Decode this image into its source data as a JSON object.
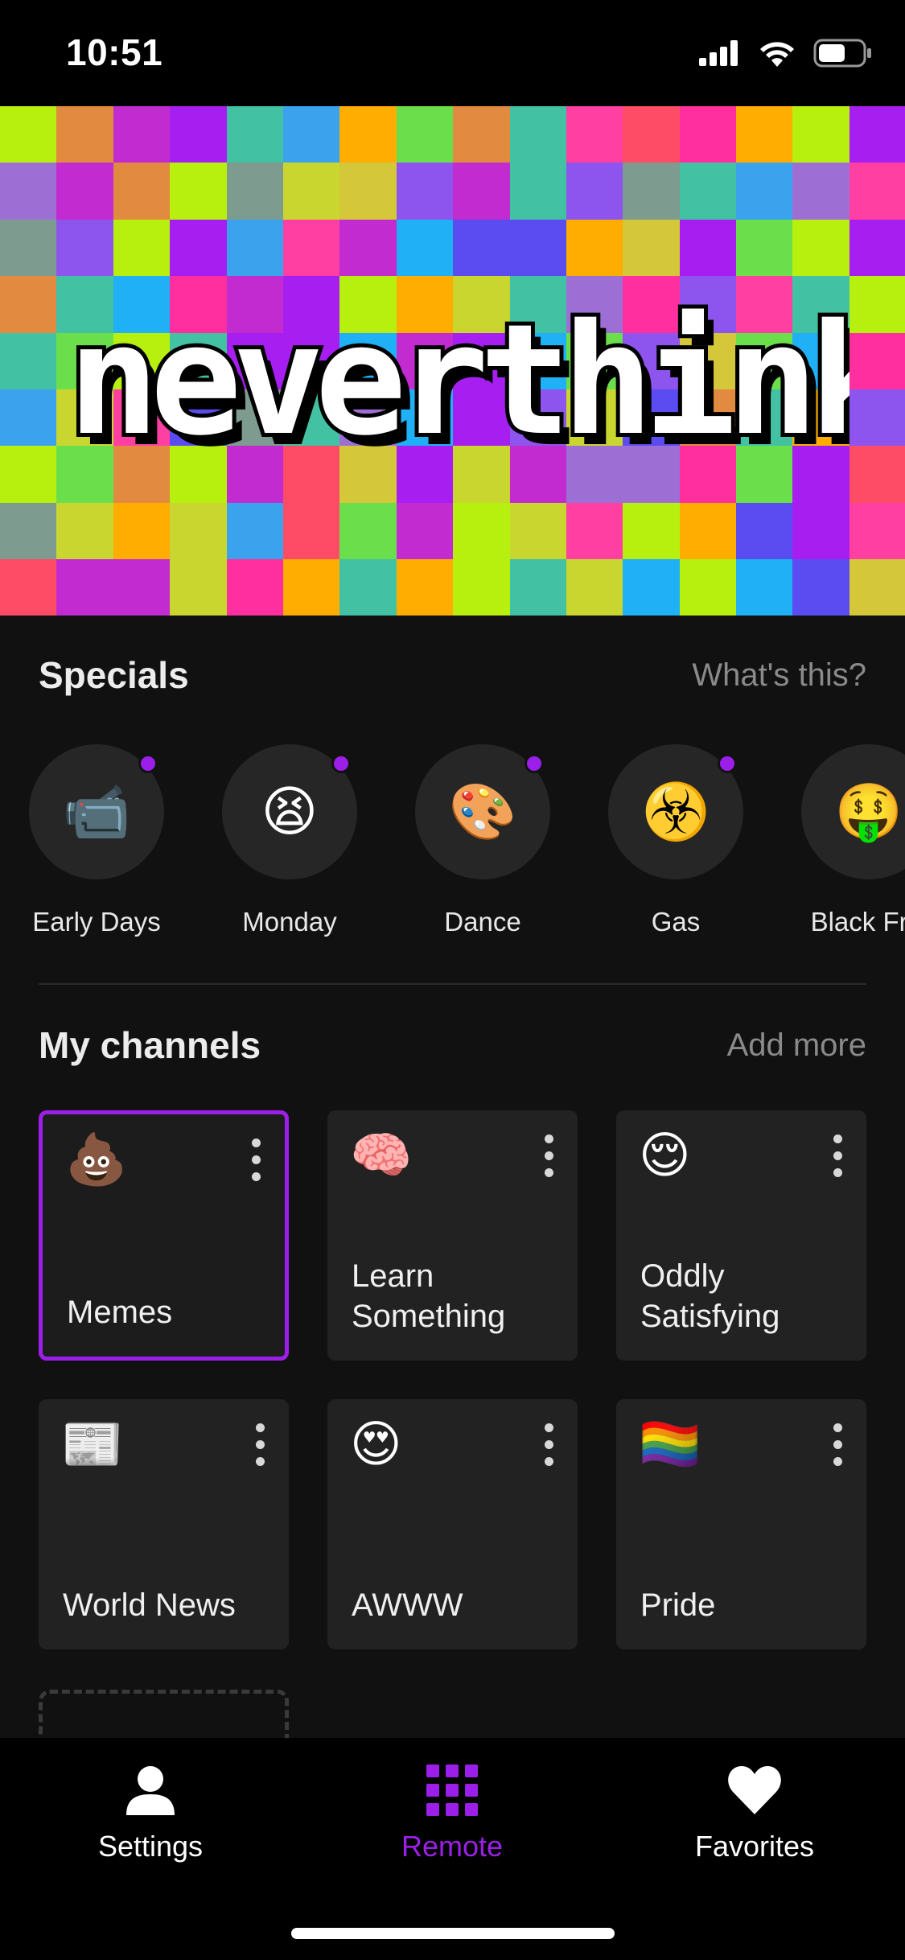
{
  "status_bar": {
    "time": "10:51"
  },
  "banner": {
    "logo_text": "neverthink"
  },
  "specials": {
    "title": "Specials",
    "link": "What's this?",
    "items": [
      {
        "label": "Early Days",
        "emoji": "📹",
        "has_dot": true
      },
      {
        "label": "Monday",
        "emoji": "😫",
        "has_dot": true
      },
      {
        "label": "Dance",
        "emoji": "🎨",
        "has_dot": true
      },
      {
        "label": "Gas",
        "emoji": "☣️",
        "has_dot": true
      },
      {
        "label": "Black Fric",
        "emoji": "🤑",
        "has_dot": false
      }
    ]
  },
  "channels": {
    "title": "My channels",
    "link": "Add more",
    "items": [
      {
        "label": "Memes",
        "emoji": "💩",
        "selected": true
      },
      {
        "label": "Learn Something",
        "emoji": "🧠",
        "selected": false
      },
      {
        "label": "Oddly Satisfying",
        "emoji": "😌",
        "selected": false
      },
      {
        "label": "World News",
        "emoji": "📰",
        "selected": false
      },
      {
        "label": "AWWW",
        "emoji": "😍",
        "selected": false
      },
      {
        "label": "Pride",
        "emoji": "🏳️‍🌈",
        "selected": false
      }
    ]
  },
  "nav": {
    "settings": "Settings",
    "remote": "Remote",
    "favorites": "Favorites",
    "active": "remote"
  },
  "colors": {
    "accent": "#9b1fe8",
    "background": "#111111",
    "tile": "#222222"
  }
}
